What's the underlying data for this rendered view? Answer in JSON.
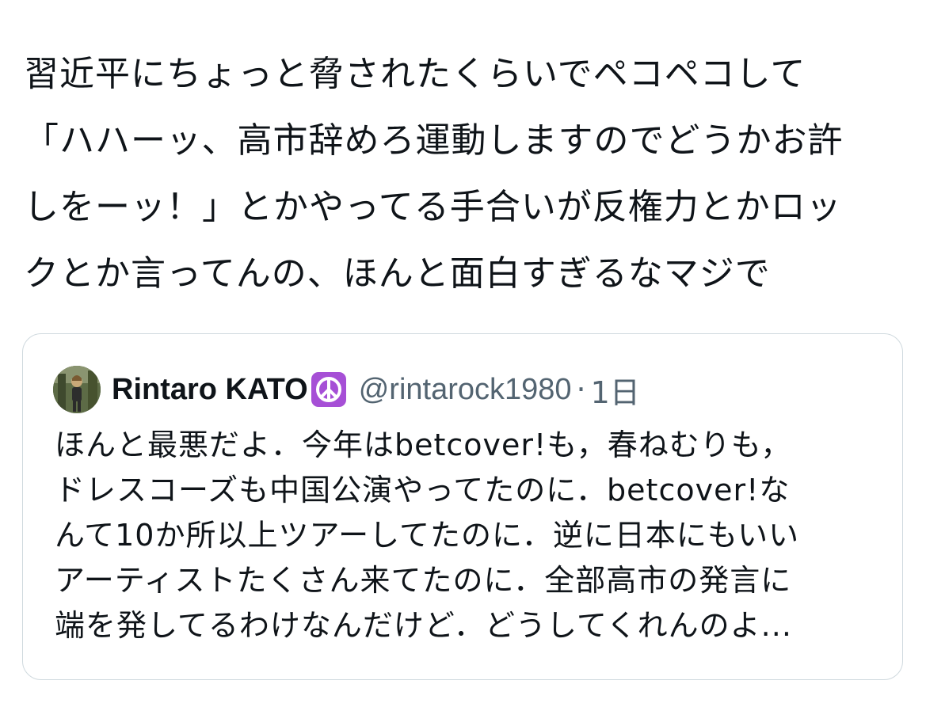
{
  "post": {
    "lines": [
      "習近平にちょっと脅されたくらいでペコペコして",
      "「ハハーッ、高市辞めろ運動しますのでどうかお許",
      "しをーッ！」とかやってる手合いが反権力とかロッ",
      "クとか言ってんの、ほんと面白すぎるなマジで"
    ]
  },
  "quote": {
    "display_name": "Rintaro KATO",
    "badge_icon": "peace-symbol-icon",
    "badge_color": "#a64fd6",
    "handle": "@rintarock1980",
    "separator": "·",
    "time": "1日",
    "lines": [
      "ほんと最悪だよ．今年はbetcover!も，春ねむりも，",
      "ドレスコーズも中国公演やってたのに．betcover!な",
      "んて10か所以上ツアーしてたのに．逆に日本にもいい",
      "アーティストたくさん来てたのに．全部高市の発言に",
      "端を発してるわけなんだけど．どうしてくれんのよ..."
    ]
  },
  "colors": {
    "text": "#0f1419",
    "secondary": "#536471",
    "border": "#cfd9de"
  }
}
